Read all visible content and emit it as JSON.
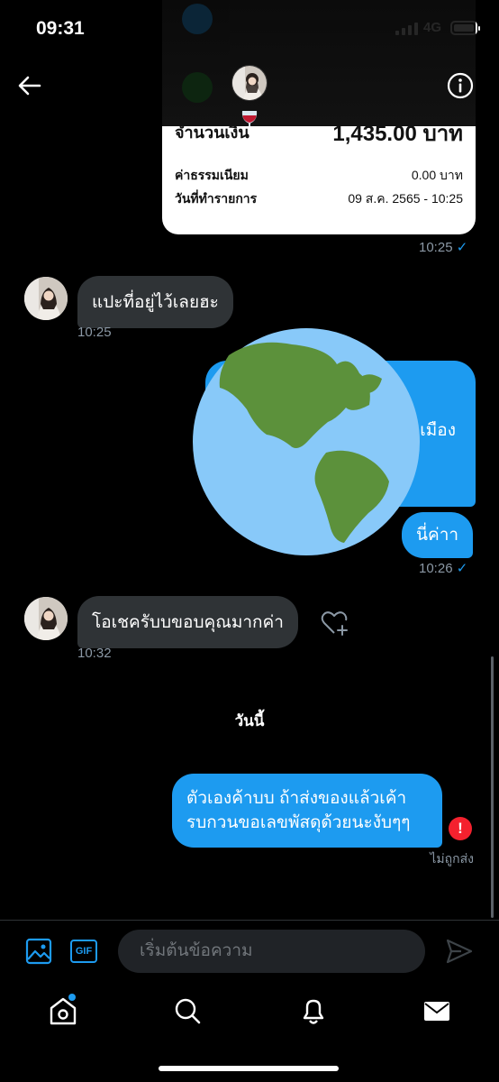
{
  "status_bar": {
    "time": "09:31",
    "network": "4G"
  },
  "receipt": {
    "partial_label": "จำนวนเงิน",
    "partial_value": "1,435.00 บาท",
    "rows": [
      {
        "label": "ค่าธรรมเนียม",
        "value": "0.00 บาท"
      },
      {
        "label": "วันที่ทำรายการ",
        "value": "09 ส.ค. 2565 - 10:25"
      }
    ],
    "time": "10:25"
  },
  "messages": {
    "m1": {
      "text": "แปะที่อยู่ไว้เลยฮะ",
      "time": "10:25"
    },
    "m2": {
      "partial_text": "เมือง"
    },
    "m3": {
      "text": "นี่ค่าา",
      "time": "10:26"
    },
    "m4": {
      "text": "โอเชครับบขอบคุณมากค่า",
      "time": "10:32"
    },
    "day_separator": "วันนี้",
    "m5": {
      "line1": "ตัวเองค้าบบ ถ้าส่งของแล้วเค้า",
      "line2": "รบกวนขอเลขพัสดุด้วยนะงับๆๆ",
      "status": "ไม่ถูกส่ง"
    }
  },
  "composer": {
    "placeholder": "เริ่มต้นข้อความ",
    "gif_label": "GIF"
  },
  "colors": {
    "accent": "#1d9bf0",
    "bubble_in": "#2f3336",
    "error": "#f4212e"
  },
  "icons": [
    "back-arrow-icon",
    "info-icon",
    "wine-glass-icon",
    "globe-emoji-icon",
    "heart-add-icon",
    "image-icon",
    "send-icon",
    "home-icon",
    "search-icon",
    "bell-icon",
    "mail-icon",
    "error-icon"
  ]
}
